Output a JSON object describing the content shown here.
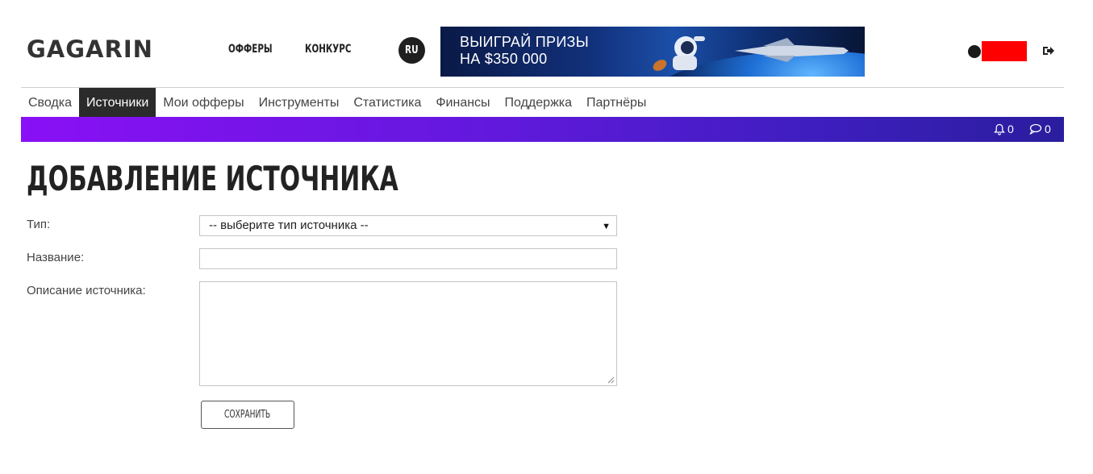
{
  "header": {
    "logo": "GAGARIN",
    "links": [
      "ОФФЕРЫ",
      "КОНКУРС"
    ],
    "lang": "RU",
    "banner": {
      "line1": "ВЫИГРАЙ ПРИЗЫ",
      "line2": "НА $350 000"
    },
    "user_name_redacted_color": "#ff0000"
  },
  "nav": {
    "items": [
      {
        "label": "Сводка",
        "active": false
      },
      {
        "label": "Источники",
        "active": true
      },
      {
        "label": "Мои офферы",
        "active": false
      },
      {
        "label": "Инструменты",
        "active": false
      },
      {
        "label": "Статистика",
        "active": false
      },
      {
        "label": "Финансы",
        "active": false
      },
      {
        "label": "Поддержка",
        "active": false
      },
      {
        "label": "Партнёры",
        "active": false
      }
    ],
    "notifications_count": "0",
    "messages_count": "0"
  },
  "page": {
    "title": "ДОБАВЛЕНИЕ ИСТОЧНИКА"
  },
  "form": {
    "type_label": "Тип:",
    "type_selected": "-- выберите тип источника --",
    "name_label": "Название:",
    "name_value": "",
    "description_label": "Описание источника:",
    "description_value": "",
    "save_label": "СОХРАНИТЬ"
  },
  "colors": {
    "accent_bar_start": "#8a10f5",
    "accent_bar_end": "#2a1d9e",
    "active_tab": "#2b2b2b"
  },
  "icons": [
    "bell-icon",
    "chat-icon",
    "logout-icon",
    "dropdown-arrow-icon",
    "resize-grip-icon"
  ]
}
